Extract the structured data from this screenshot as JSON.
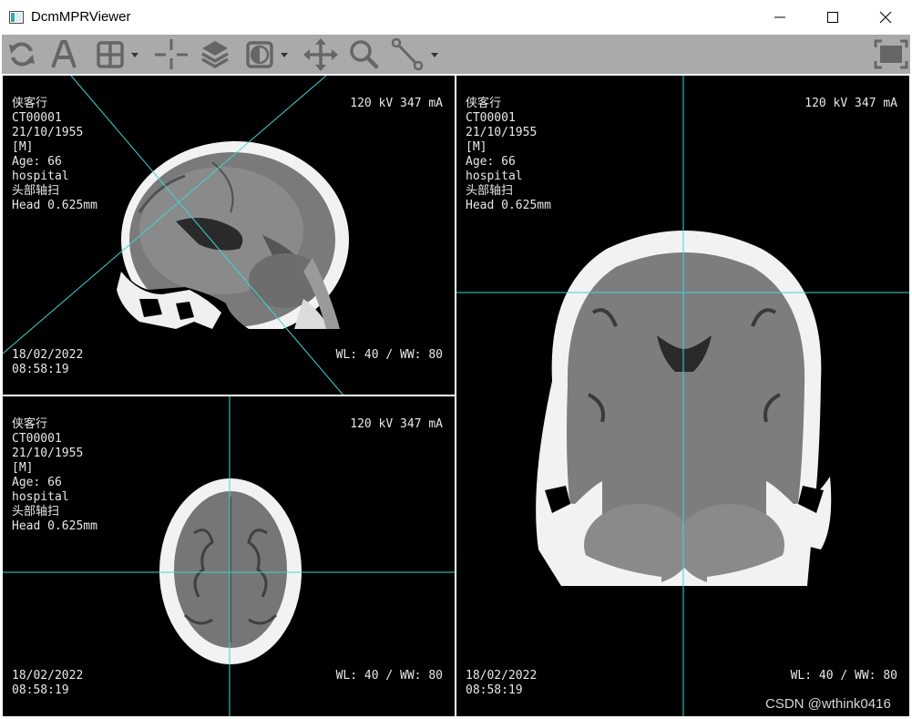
{
  "window": {
    "title": "DcmMPRViewer",
    "controls": [
      "minimize-icon",
      "maximize-icon",
      "close-icon"
    ]
  },
  "toolbar": {
    "tools": [
      {
        "name": "reset",
        "icon": "refresh-icon"
      },
      {
        "name": "annotation",
        "icon": "text-a-icon"
      },
      {
        "name": "layout",
        "icon": "grid-icon",
        "has_dropdown": true
      },
      {
        "name": "crosshair",
        "icon": "crosshair-icon"
      },
      {
        "name": "layers",
        "icon": "layers-icon"
      },
      {
        "name": "window-level",
        "icon": "contrast-icon",
        "has_dropdown": true
      },
      {
        "name": "pan",
        "icon": "move-icon"
      },
      {
        "name": "zoom",
        "icon": "magnifier-icon"
      },
      {
        "name": "measure",
        "icon": "ruler-line-icon",
        "has_dropdown": true
      },
      {
        "name": "fullscreen",
        "icon": "fullscreen-icon"
      }
    ],
    "background": "#aaaaaa"
  },
  "overlay": {
    "patient_name": "侠客行",
    "patient_id": "CT00001",
    "birth_date": "21/10/1955",
    "sex": "[M]",
    "age": "Age: 66",
    "institution": "hospital",
    "study_desc": "头部轴扫",
    "series_desc": "Head 0.625mm",
    "acq_params": "120 kV 347 mA",
    "study_date": "18/02/2022",
    "study_time": "08:58:19",
    "window": "WL: 40 / WW: 80"
  },
  "viewports": [
    {
      "name": "sagittal"
    },
    {
      "name": "axial"
    },
    {
      "name": "coronal"
    }
  ],
  "colors": {
    "crosshair": "#3fd6d6",
    "viewport_bg": "#000000",
    "overlay_text": "#e8e8e8"
  },
  "watermark": "CSDN @wthink0416"
}
